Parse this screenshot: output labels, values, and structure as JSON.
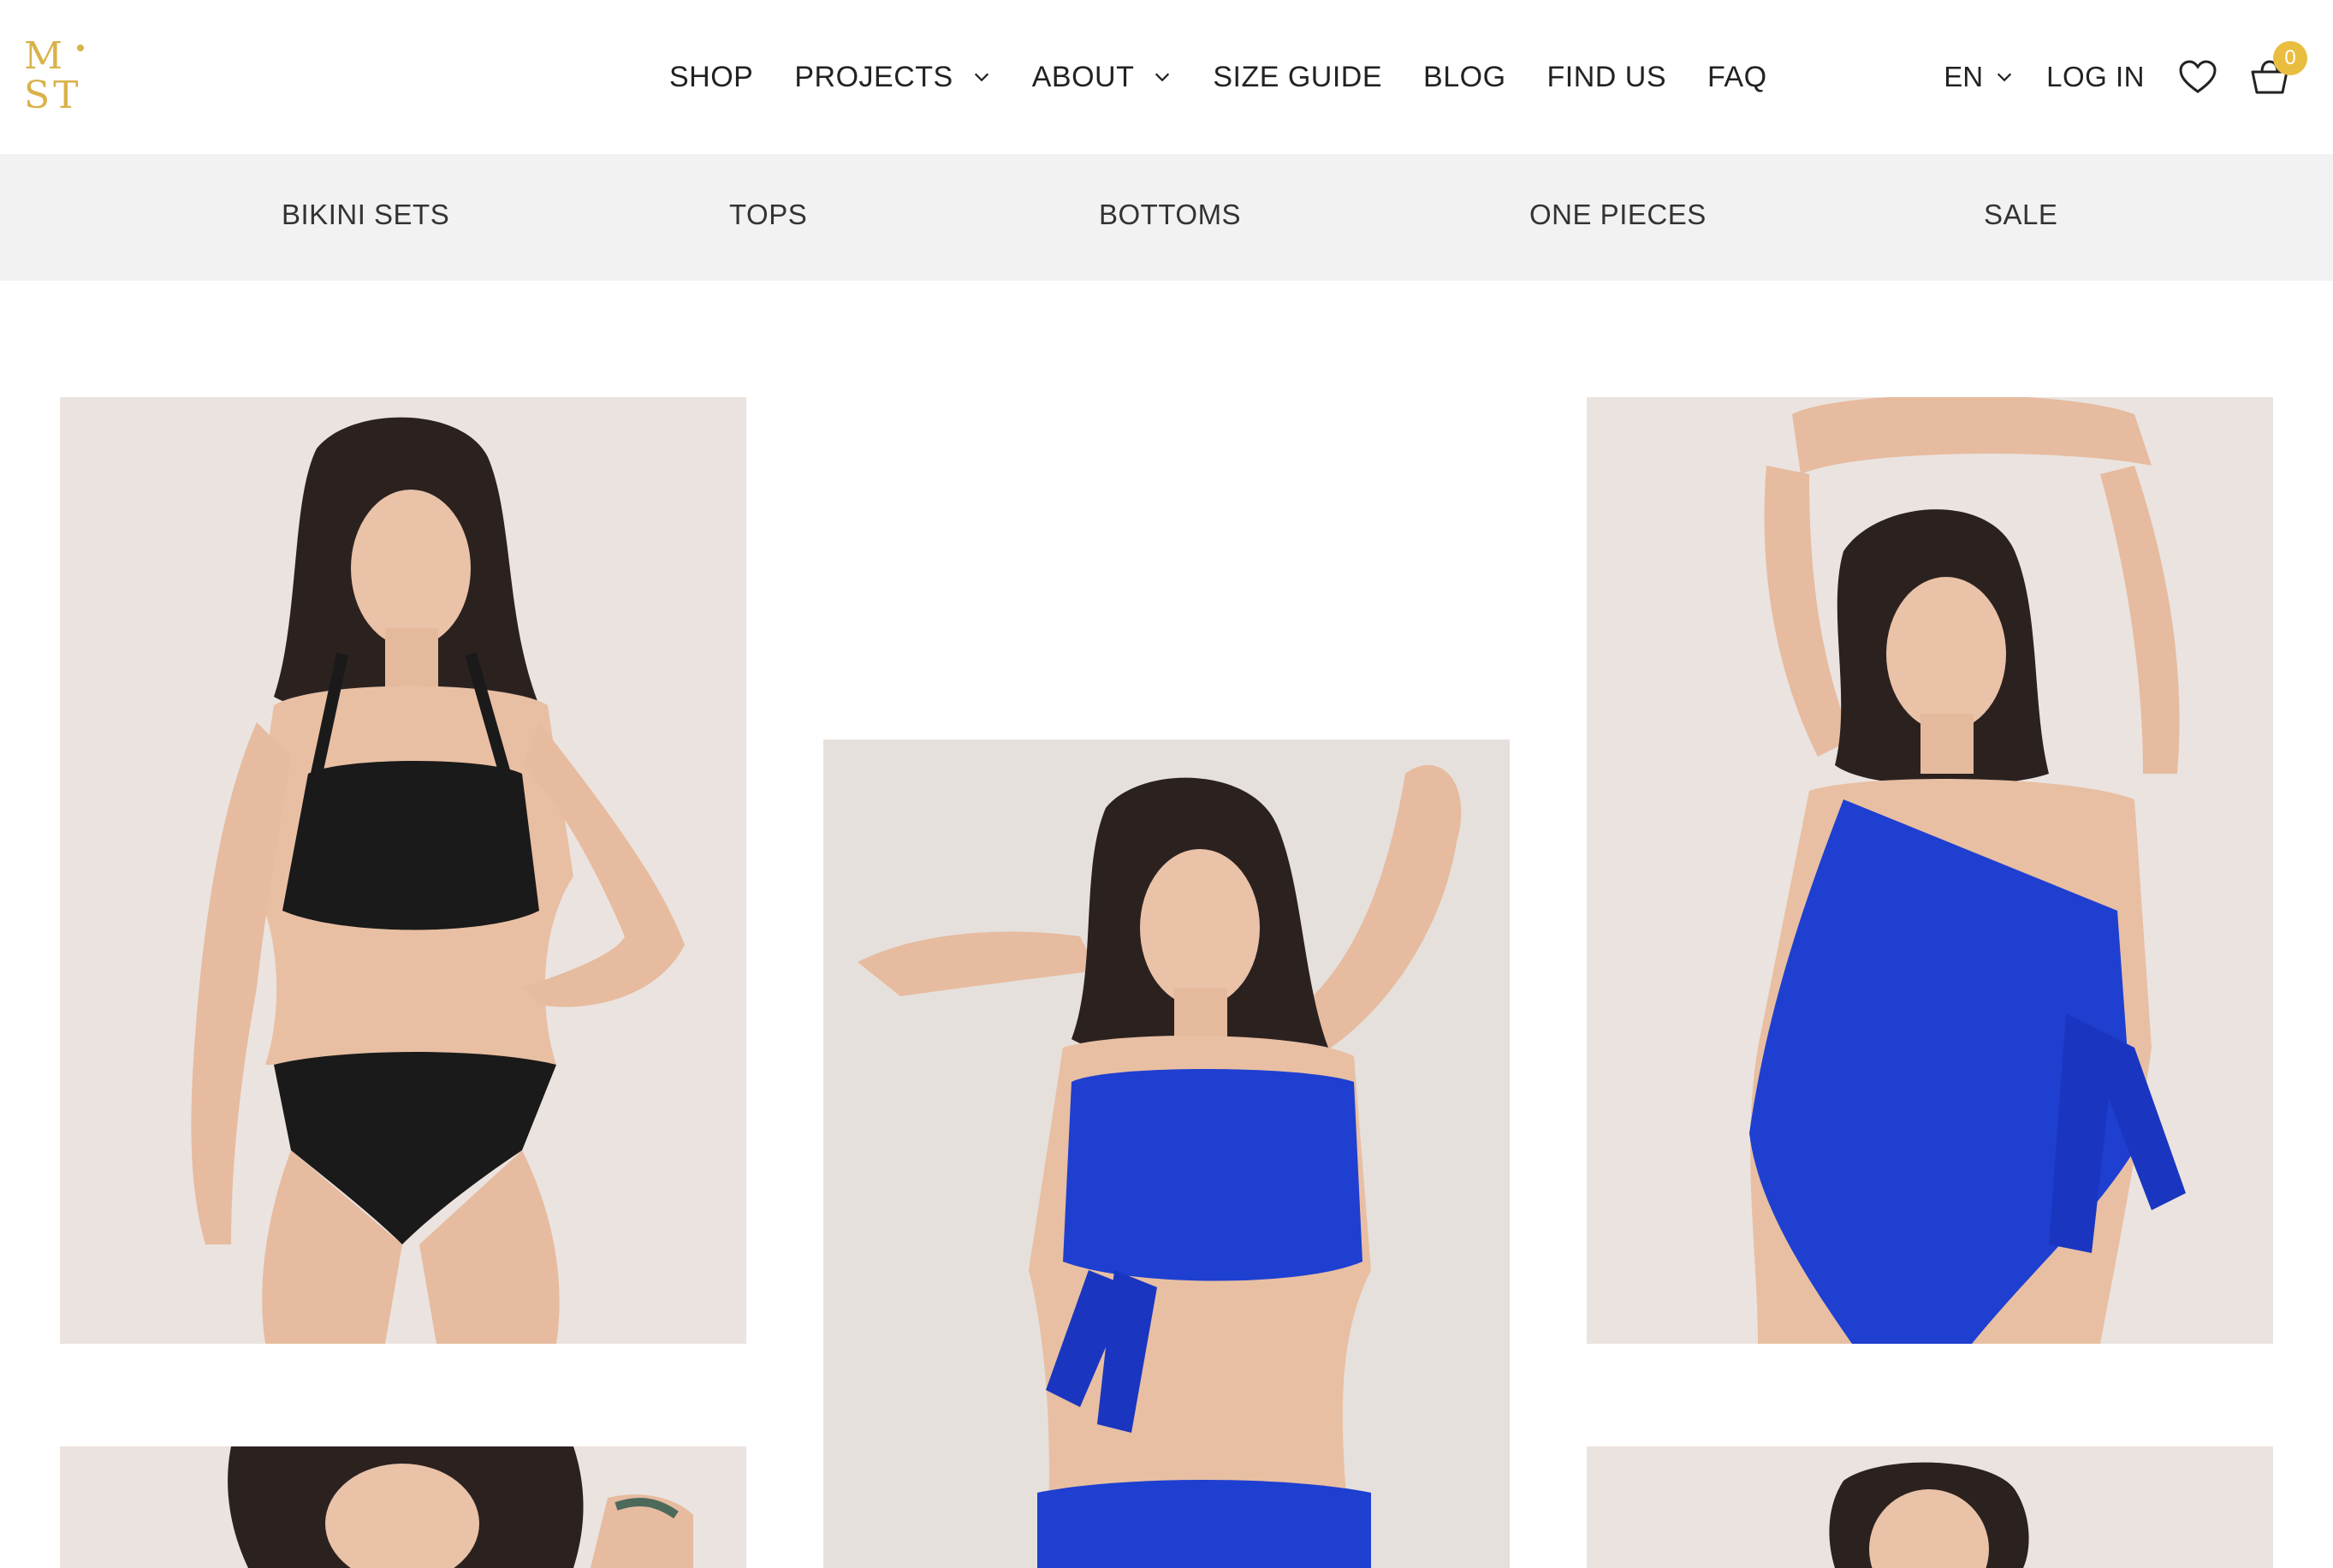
{
  "logo": {
    "line1": "M",
    "line2": "ST",
    "brand_color": "#d9b24a"
  },
  "main_nav": {
    "items": [
      {
        "label": "SHOP",
        "has_dropdown": false
      },
      {
        "label": "PROJECTS",
        "has_dropdown": true
      },
      {
        "label": "ABOUT",
        "has_dropdown": true
      },
      {
        "label": "SIZE GUIDE",
        "has_dropdown": false
      },
      {
        "label": "BLOG",
        "has_dropdown": false
      },
      {
        "label": "FIND US",
        "has_dropdown": false
      },
      {
        "label": "FAQ",
        "has_dropdown": false
      }
    ]
  },
  "tools": {
    "language": "EN",
    "login_label": "LOG IN",
    "wishlist_icon": "heart-icon",
    "cart_icon": "basket-icon",
    "cart_count": "0",
    "accent_color": "#e9bd3f"
  },
  "sub_nav": {
    "items": [
      {
        "label": "BIKINI SETS"
      },
      {
        "label": "TOPS"
      },
      {
        "label": "BOTTOMS"
      },
      {
        "label": "ONE PIECES"
      },
      {
        "label": "SALE"
      }
    ]
  },
  "products": [
    {
      "image": "model-black-bikini-set",
      "swimwear_color": "#1a1a1a"
    },
    {
      "image": "model-blue-wrap-bikini",
      "swimwear_color": "#1f3fd0"
    },
    {
      "image": "model-blue-one-piece",
      "swimwear_color": "#1f3fd0"
    },
    {
      "image": "model-partial-bottom-left"
    },
    {
      "image": "model-partial-bottom-right"
    }
  ]
}
